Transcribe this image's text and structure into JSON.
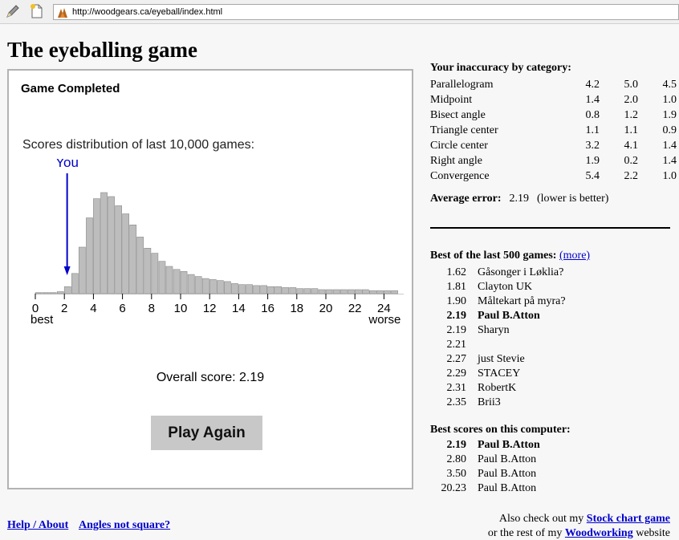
{
  "browser": {
    "url": "http://woodgears.ca/eyeball/index.html"
  },
  "page": {
    "title": "The eyeballing game"
  },
  "game": {
    "status": "Game Completed",
    "distribution_title": "Scores distribution of last 10,000 games:",
    "overall_label": "Overall score: 2.19",
    "play_again_label": "Play Again"
  },
  "chart_data": {
    "type": "bar",
    "title": "Scores distribution of last 10,000 games:",
    "x": [
      0,
      0.5,
      1,
      1.5,
      2,
      2.5,
      3,
      3.5,
      4,
      4.5,
      5,
      5.5,
      6,
      6.5,
      7,
      7.5,
      8,
      8.5,
      9,
      9.5,
      10,
      10.5,
      11,
      11.5,
      12,
      12.5,
      13,
      13.5,
      14,
      14.5,
      15,
      15.5,
      16,
      16.5,
      17,
      17.5,
      18,
      18.5,
      19,
      19.5,
      20,
      20.5,
      21,
      21.5,
      22,
      22.5,
      23,
      23.5,
      24,
      24.5
    ],
    "values": [
      1,
      1,
      1,
      2,
      7,
      20,
      46,
      75,
      94,
      100,
      96,
      87,
      79,
      68,
      56,
      45,
      40,
      32,
      27,
      24,
      22,
      19,
      17,
      15,
      14,
      13,
      12,
      10,
      9,
      9,
      8,
      8,
      7,
      7,
      6,
      6,
      5,
      5,
      5,
      4,
      4,
      4,
      4,
      4,
      4,
      4,
      3,
      3,
      3,
      3
    ],
    "xticks": [
      "0",
      "2",
      "4",
      "6",
      "8",
      "10",
      "12",
      "14",
      "16",
      "18",
      "20",
      "22",
      "24"
    ],
    "xlim": [
      0,
      25
    ],
    "you": 2.19,
    "labels": {
      "you": "You",
      "best": "best",
      "worse": "worse"
    },
    "colors": {
      "bar": "#bdbdbd",
      "bar_stroke": "#8a8a8a",
      "marker": "#0000cc"
    }
  },
  "inaccuracy": {
    "heading": "Your inaccuracy by category:",
    "rows": [
      {
        "name": "Parallelogram",
        "values": [
          "4.2",
          "5.0",
          "4.5"
        ]
      },
      {
        "name": "Midpoint",
        "values": [
          "1.4",
          "2.0",
          "1.0"
        ]
      },
      {
        "name": "Bisect angle",
        "values": [
          "0.8",
          "1.2",
          "1.9"
        ]
      },
      {
        "name": "Triangle center",
        "values": [
          "1.1",
          "1.1",
          "0.9"
        ]
      },
      {
        "name": "Circle center",
        "values": [
          "3.2",
          "4.1",
          "1.4"
        ]
      },
      {
        "name": "Right angle",
        "values": [
          "1.9",
          "0.2",
          "1.4"
        ]
      },
      {
        "name": "Convergence",
        "values": [
          "5.4",
          "2.2",
          "1.0"
        ]
      }
    ],
    "average_label": "Average error:",
    "average_value": "2.19",
    "average_note": "(lower is better)"
  },
  "best_recent": {
    "heading": "Best of the last 500 games:",
    "more_link": "(more)",
    "rows": [
      {
        "score": "1.62",
        "name": "Gåsonger i Løklia?",
        "highlight": false
      },
      {
        "score": "1.81",
        "name": "Clayton UK",
        "highlight": false
      },
      {
        "score": "1.90",
        "name": "Måltekart på myra?",
        "highlight": false
      },
      {
        "score": "2.19",
        "name": "Paul B.Atton",
        "highlight": true
      },
      {
        "score": "2.19",
        "name": "Sharyn",
        "highlight": false
      },
      {
        "score": "2.21",
        "name": "",
        "highlight": false
      },
      {
        "score": "2.27",
        "name": "just Stevie",
        "highlight": false
      },
      {
        "score": "2.29",
        "name": "STACEY",
        "highlight": false
      },
      {
        "score": "2.31",
        "name": "RobertK",
        "highlight": false
      },
      {
        "score": "2.35",
        "name": "Brii3",
        "highlight": false
      }
    ]
  },
  "best_local": {
    "heading": "Best scores on this computer:",
    "rows": [
      {
        "score": "2.19",
        "name": "Paul B.Atton",
        "highlight": true
      },
      {
        "score": "2.80",
        "name": "Paul B.Atton",
        "highlight": false
      },
      {
        "score": "3.50",
        "name": "Paul B.Atton",
        "highlight": false
      },
      {
        "score": "20.23",
        "name": "Paul B.Atton",
        "highlight": false
      }
    ]
  },
  "footer": {
    "help_link": "Help / About",
    "angles_link": "Angles not square?",
    "line1_prefix": "Also check out my ",
    "line1_link": "Stock chart game",
    "line2_prefix": "or the rest of my ",
    "line2_link": "Woodworking",
    "line2_suffix": " website"
  }
}
